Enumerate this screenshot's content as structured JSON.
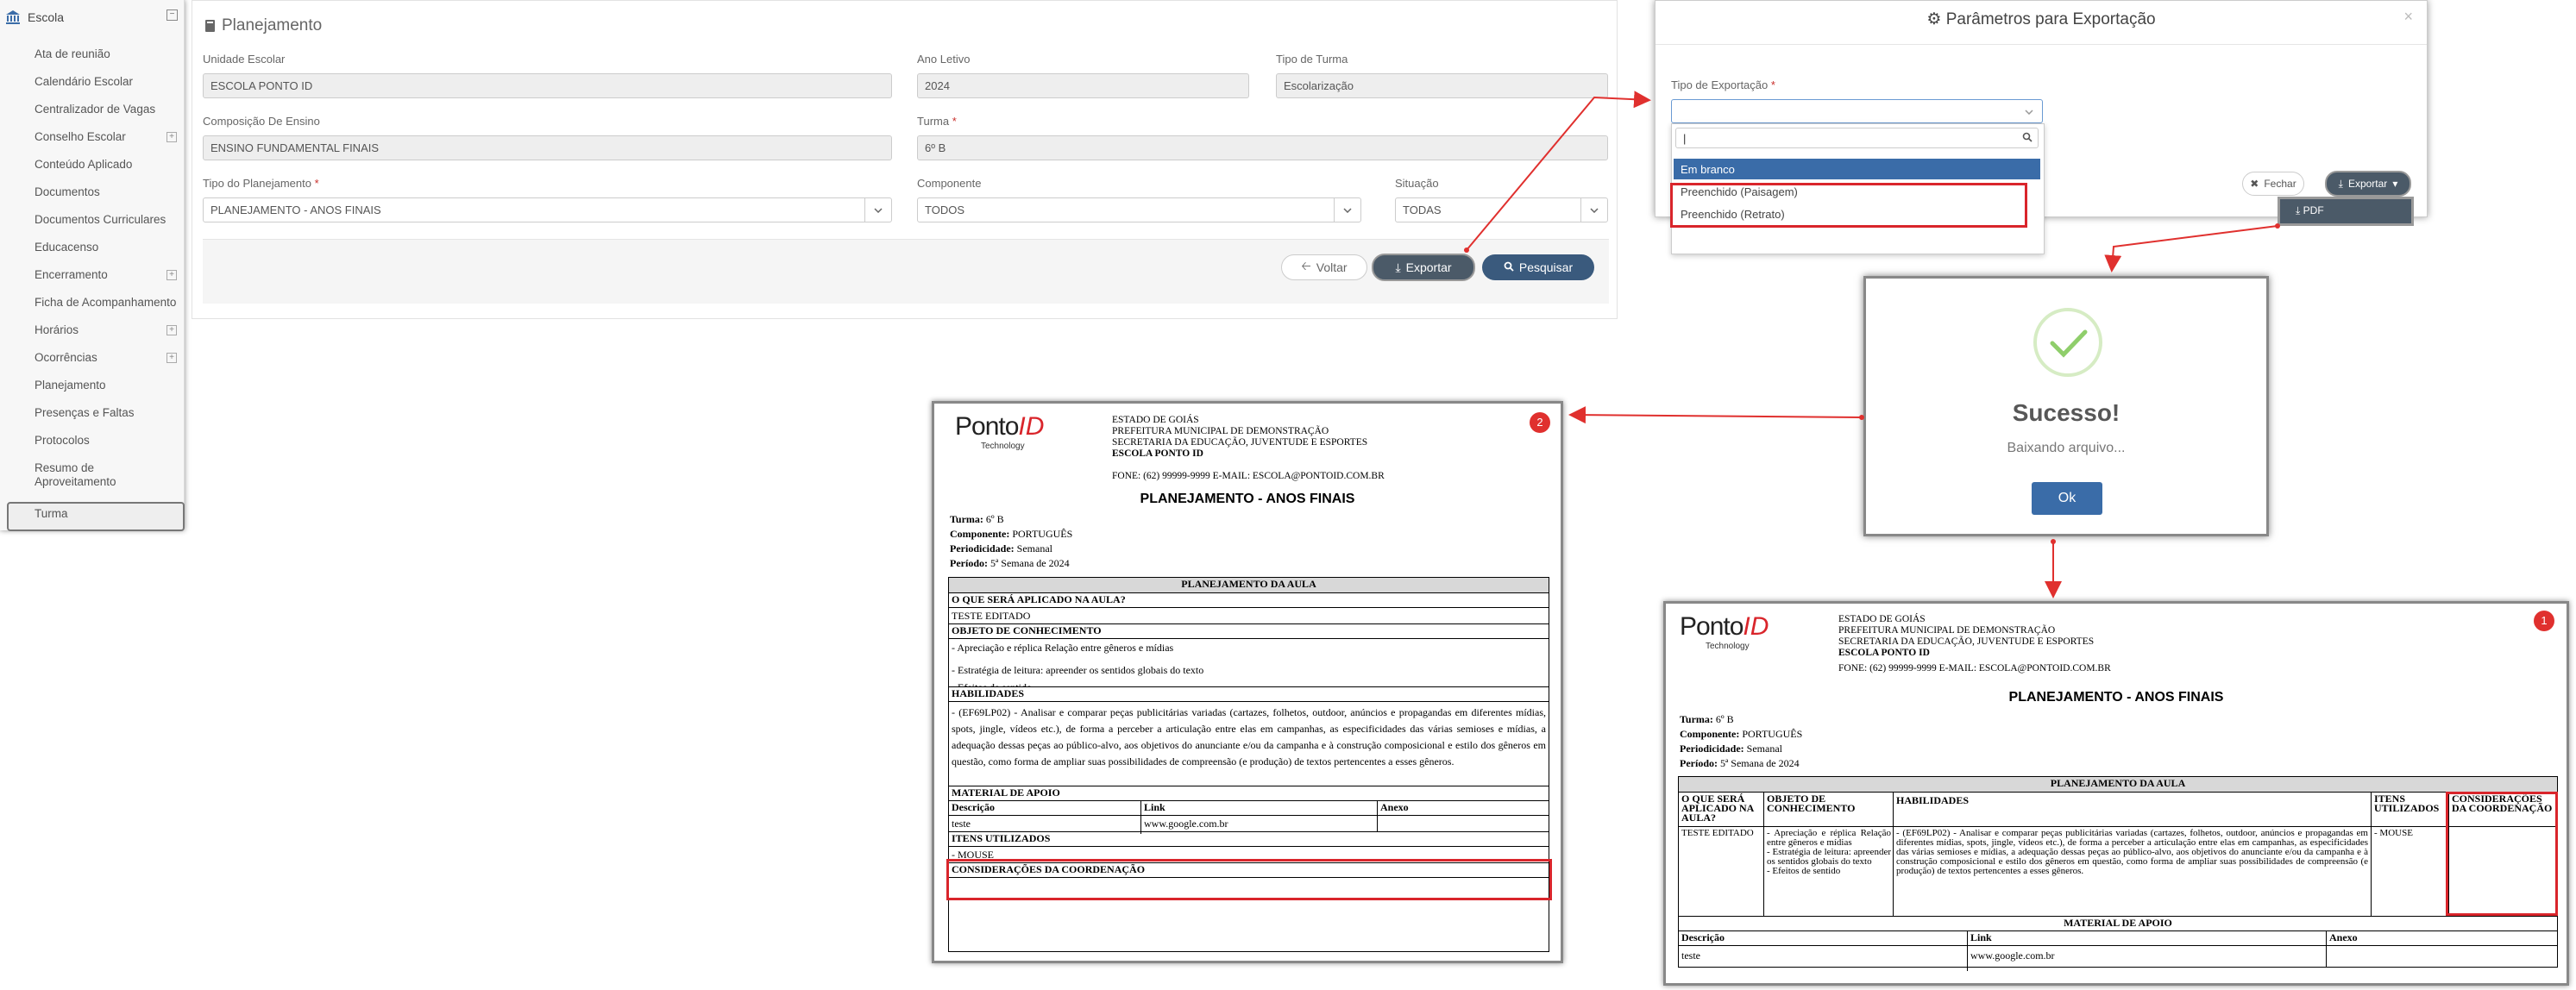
{
  "sidebar": {
    "header": "Escola",
    "items": [
      {
        "label": "Ata de reunião"
      },
      {
        "label": "Calendário Escolar"
      },
      {
        "label": "Centralizador de Vagas"
      },
      {
        "label": "Conselho Escolar"
      },
      {
        "label": "Conteúdo Aplicado"
      },
      {
        "label": "Documentos"
      },
      {
        "label": "Documentos Curriculares"
      },
      {
        "label": "Educacenso"
      },
      {
        "label": "Encerramento"
      },
      {
        "label": "Ficha de Acompanhamento"
      },
      {
        "label": "Horários"
      },
      {
        "label": "Ocorrências"
      },
      {
        "label": "Planejamento"
      },
      {
        "label": "Presenças e Faltas"
      },
      {
        "label": "Protocolos"
      },
      {
        "label": "Resumo de Aproveitamento"
      },
      {
        "label": "Turma"
      }
    ]
  },
  "plan": {
    "title": "Planejamento",
    "unidade_label": "Unidade Escolar",
    "unidade_value": "ESCOLA PONTO ID",
    "ano_label": "Ano Letivo",
    "ano_value": "2024",
    "tipo_turma_label": "Tipo de Turma",
    "tipo_turma_value": "Escolarização",
    "composicao_label": "Composição De Ensino",
    "composicao_value": "ENSINO FUNDAMENTAL FINAIS",
    "turma_label": "Turma",
    "turma_value": "6º B",
    "tipo_plan_label": "Tipo do Planejamento",
    "tipo_plan_value": "PLANEJAMENTO - ANOS FINAIS",
    "componente_label": "Componente",
    "componente_value": "TODOS",
    "situacao_label": "Situação",
    "situacao_value": "TODAS",
    "voltar": "Voltar",
    "exportar": "Exportar",
    "pesquisar": "Pesquisar"
  },
  "modal": {
    "title": "Parâmetros para Exportação",
    "tipo_label": "Tipo de Exportação",
    "options": [
      "Em branco",
      "Preenchido (Paisagem)",
      "Preenchido (Retrato)"
    ],
    "fechar": "Fechar",
    "exportar": "Exportar",
    "pdf": "PDF"
  },
  "success": {
    "title": "Sucesso!",
    "message": "Baixando arquivo...",
    "ok": "Ok"
  },
  "document": {
    "logo_main": "Ponto",
    "logo_id": "ID",
    "logo_sub": "Technology",
    "header_lines": [
      "ESTADO DE GOIÁS",
      "PREFEITURA MUNICIPAL DE DEMONSTRAÇÃO",
      "SECRETARIA DA EDUCAÇÃO, JUVENTUDE E ESPORTES",
      "ESCOLA PONTO ID"
    ],
    "contact": "FONE: (62) 99999-9999 E-MAIL: ESCOLA@PONTOID.COM.BR",
    "title": "PLANEJAMENTO - ANOS FINAIS",
    "turma_k": "Turma:",
    "turma_v": "6º B",
    "componente_k": "Componente:",
    "componente_v": "PORTUGUÊS",
    "periodicidade_k": "Periodicidade:",
    "periodicidade_v": "Semanal",
    "periodo_k": "Período:",
    "periodo_v": "5ª Semana de 2024",
    "sec_planejamento": "PLANEJAMENTO DA AULA",
    "sec_o_que": "O QUE SERÁ APLICADO NA AULA?",
    "o_que_value": "TESTE EDITADO",
    "sec_objeto": "OBJETO DE CONHECIMENTO",
    "objeto_1": "- Apreciação e réplica Relação entre gêneros e mídias",
    "objeto_2": "- Estratégia de leitura: apreender os sentidos globais do texto",
    "objeto_3": "- Efeitos de sentido",
    "sec_habilidades": "HABILIDADES",
    "habilidades_text": "- (EF69LP02) - Analisar e comparar peças publicitárias variadas (cartazes, folhetos, outdoor, anúncios e propagandas em diferentes mídias, spots, jingle, vídeos etc.), de forma a perceber a articulação entre elas em campanhas, as especificidades das várias semioses e mídias, a adequação dessas peças ao público-alvo, aos objetivos do anunciante e/ou da campanha e à construção composicional e estilo dos gêneros em questão, como forma de ampliar suas possibilidades de compreensão (e produção) de textos pertencentes a esses gêneros.",
    "sec_material": "MATERIAL DE APOIO",
    "col_descricao": "Descrição",
    "col_link": "Link",
    "col_anexo": "Anexo",
    "material_desc": "teste",
    "material_link": "www.google.com.br",
    "sec_itens": "ITENS UTILIZADOS",
    "itens_value": "- MOUSE",
    "sec_consideracoes": "CONSIDERAÇÕES DA COORDENAÇÃO",
    "col_itens_short": "ITENS UTILIZADOS",
    "col_consid_short": "CONSIDERAÇÕES DA COORDENAÇÃO",
    "o_que_short": "TESTE EDITADO"
  },
  "badges": {
    "portrait": "2",
    "landscape": "1"
  },
  "colors": {
    "dark_button": "#4b5a68",
    "primary_button": "#3a5a7d",
    "highlight": "#d9252b",
    "selected_option": "#3a6ca8"
  }
}
